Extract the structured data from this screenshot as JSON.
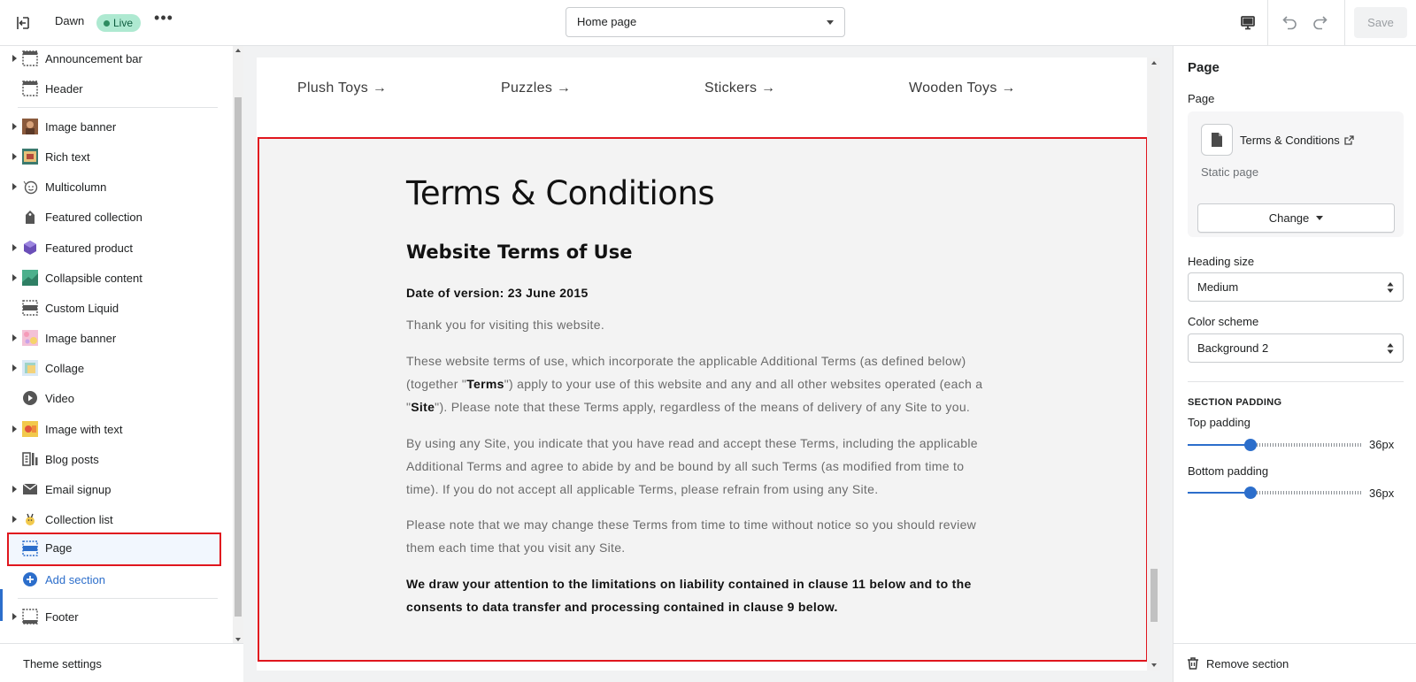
{
  "topbar": {
    "theme_name": "Dawn",
    "live_label": "Live",
    "more_label": "•••",
    "page_select_value": "Home page",
    "save_label": "Save"
  },
  "sidebar": {
    "items": [
      {
        "label": "Announcement bar",
        "expandable": true,
        "icon": "announcement-bar-icon"
      },
      {
        "label": "Header",
        "expandable": false,
        "icon": "header-icon"
      },
      {
        "label": "Image banner",
        "expandable": true,
        "icon": "image-banner-thumbnail"
      },
      {
        "label": "Rich text",
        "expandable": true,
        "icon": "rich-text-thumbnail"
      },
      {
        "label": "Multicolumn",
        "expandable": true,
        "icon": "multicolumn-thumbnail"
      },
      {
        "label": "Featured collection",
        "expandable": false,
        "icon": "tag-icon"
      },
      {
        "label": "Featured product",
        "expandable": true,
        "icon": "product-thumbnail"
      },
      {
        "label": "Collapsible content",
        "expandable": true,
        "icon": "collapsible-thumbnail"
      },
      {
        "label": "Custom Liquid",
        "expandable": false,
        "icon": "custom-liquid-icon"
      },
      {
        "label": "Image banner",
        "expandable": true,
        "icon": "image-banner-thumbnail-2"
      },
      {
        "label": "Collage",
        "expandable": true,
        "icon": "collage-thumbnail"
      },
      {
        "label": "Video",
        "expandable": false,
        "icon": "play-icon"
      },
      {
        "label": "Image with text",
        "expandable": true,
        "icon": "image-with-text-thumbnail"
      },
      {
        "label": "Blog posts",
        "expandable": false,
        "icon": "blog-icon"
      },
      {
        "label": "Email signup",
        "expandable": true,
        "icon": "email-icon"
      },
      {
        "label": "Collection list",
        "expandable": true,
        "icon": "collection-list-thumbnail"
      },
      {
        "label": "Page",
        "expandable": false,
        "icon": "page-section-icon"
      }
    ],
    "add_section_label": "Add section",
    "footer_label": "Footer",
    "theme_settings_label": "Theme settings"
  },
  "preview": {
    "collection_links": [
      "Plush Toys →",
      "Puzzles →",
      "Stickers →",
      "Wooden Toys →"
    ],
    "page_title": "Terms & Conditions",
    "subtitle": "Website Terms of Use",
    "date_line": "Date of version: 23 June 2015",
    "p1": "Thank you for visiting this website.",
    "p2_a": "These website terms of use, which incorporate the applicable Additional Terms (as defined below) (together \"",
    "p2_b": "Terms",
    "p2_c": "\") apply to your use of this website and any and all other websites operated (each a \"",
    "p2_d": "Site",
    "p2_e": "\"). Please note that these Terms apply, regardless of the means of delivery of any Site to you.",
    "p3": "By using any Site, you indicate that you have read and accept these Terms, including the applicable Additional Terms and agree to abide by and be bound by all such Terms (as modified from time to time). If you do not accept all applicable Terms, please refrain from using any Site.",
    "p4": "Please note that we may change these Terms from time to time without notice so you should review them each time that you visit any Site.",
    "p5": "We draw your attention to the limitations on liability contained in clause 11 below and to the consents to data transfer and processing contained in clause 9 below."
  },
  "settings": {
    "panel_title": "Page",
    "page_label": "Page",
    "page_name": "Terms & Conditions",
    "page_kind": "Static page",
    "change_label": "Change",
    "heading_size_label": "Heading size",
    "heading_size_value": "Medium",
    "color_scheme_label": "Color scheme",
    "color_scheme_value": "Background 2",
    "section_padding_label": "SECTION PADDING",
    "top_padding_label": "Top padding",
    "top_padding_value": "36px",
    "bottom_padding_label": "Bottom padding",
    "bottom_padding_value": "36px",
    "padding_level_fraction": 0.36,
    "remove_label": "Remove section"
  },
  "colors": {
    "accent": "#2c6ecb",
    "selection_outline": "#e0161e",
    "live_badge": "#aee9d1",
    "section_bg": "#f3f3f3"
  }
}
